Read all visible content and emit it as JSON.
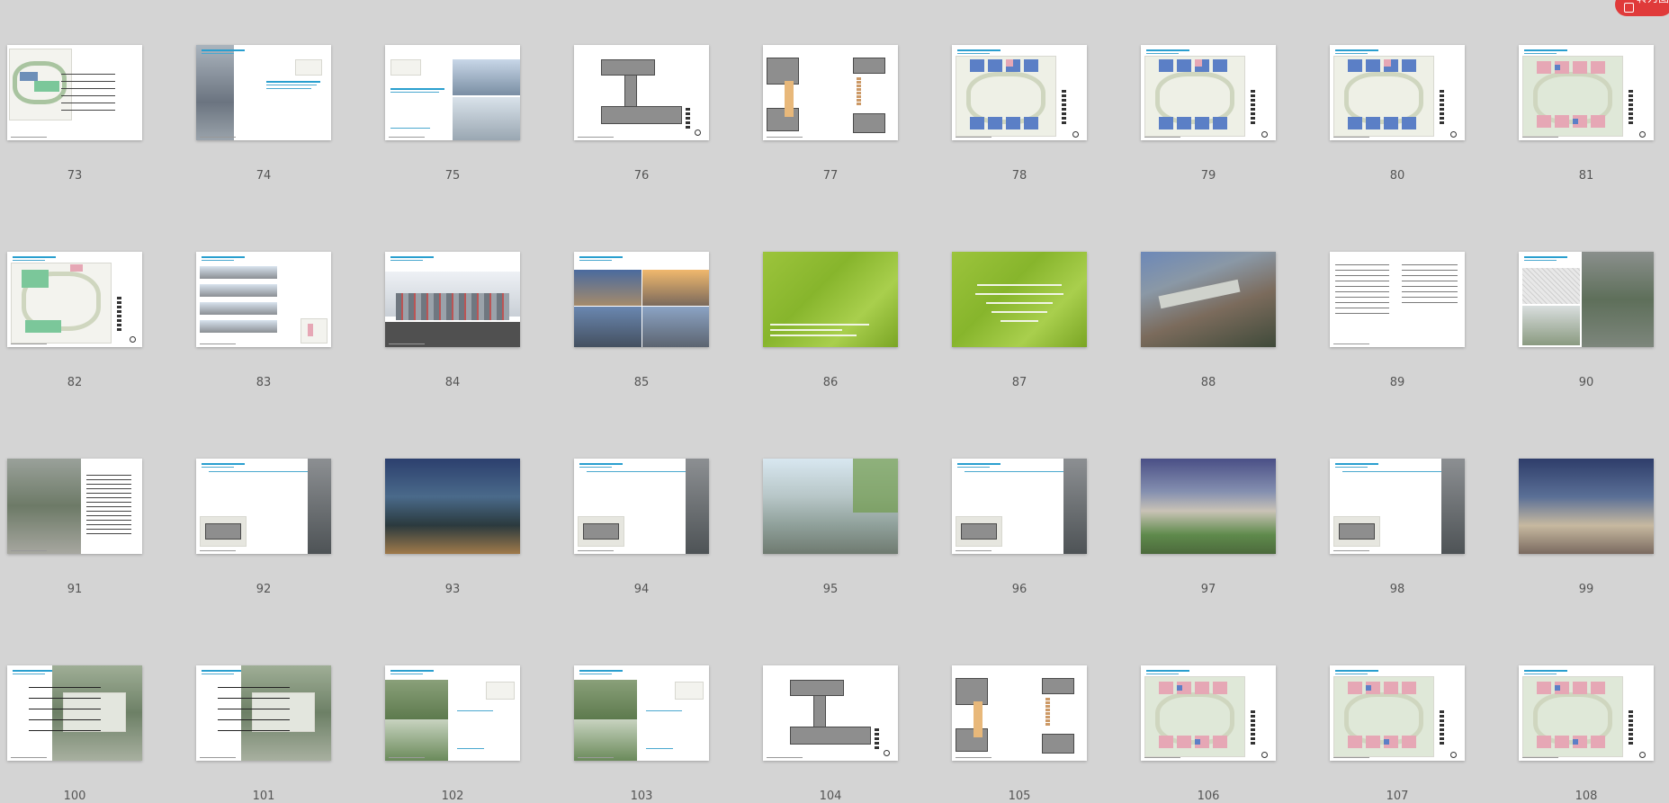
{
  "toolbar": {
    "convert_label": "转为图"
  },
  "thumbnails": [
    {
      "page": "73",
      "kind": "plan-callouts"
    },
    {
      "page": "74",
      "kind": "text-photo"
    },
    {
      "page": "75",
      "kind": "photo-pair"
    },
    {
      "page": "76",
      "kind": "grey-plan"
    },
    {
      "page": "77",
      "kind": "grey-plan-detail"
    },
    {
      "page": "78",
      "kind": "masterplan"
    },
    {
      "page": "79",
      "kind": "masterplan"
    },
    {
      "page": "80",
      "kind": "masterplan"
    },
    {
      "page": "81",
      "kind": "masterplan-pink"
    },
    {
      "page": "82",
      "kind": "masterplan-green"
    },
    {
      "page": "83",
      "kind": "sections"
    },
    {
      "page": "84",
      "kind": "elevation"
    },
    {
      "page": "85",
      "kind": "photo-grid"
    },
    {
      "page": "86",
      "kind": "green-slide"
    },
    {
      "page": "87",
      "kind": "green-title"
    },
    {
      "page": "88",
      "kind": "aerial-photo"
    },
    {
      "page": "89",
      "kind": "text-page"
    },
    {
      "page": "90",
      "kind": "sketch-aerial"
    },
    {
      "page": "91",
      "kind": "aerial-table"
    },
    {
      "page": "92",
      "kind": "keyplan-photo"
    },
    {
      "page": "93",
      "kind": "night-photo"
    },
    {
      "page": "94",
      "kind": "keyplan-photo"
    },
    {
      "page": "95",
      "kind": "street-photo"
    },
    {
      "page": "96",
      "kind": "keyplan-photo"
    },
    {
      "page": "97",
      "kind": "plaza-photo"
    },
    {
      "page": "98",
      "kind": "keyplan-photo"
    },
    {
      "page": "99",
      "kind": "interior-photo"
    },
    {
      "page": "100",
      "kind": "aerial-callouts"
    },
    {
      "page": "101",
      "kind": "aerial-callouts"
    },
    {
      "page": "102",
      "kind": "photo-collage"
    },
    {
      "page": "103",
      "kind": "photo-collage"
    },
    {
      "page": "104",
      "kind": "grey-plan"
    },
    {
      "page": "105",
      "kind": "grey-plan-detail"
    },
    {
      "page": "106",
      "kind": "masterplan-pink"
    },
    {
      "page": "107",
      "kind": "masterplan-pink"
    },
    {
      "page": "108",
      "kind": "masterplan-pink"
    }
  ]
}
